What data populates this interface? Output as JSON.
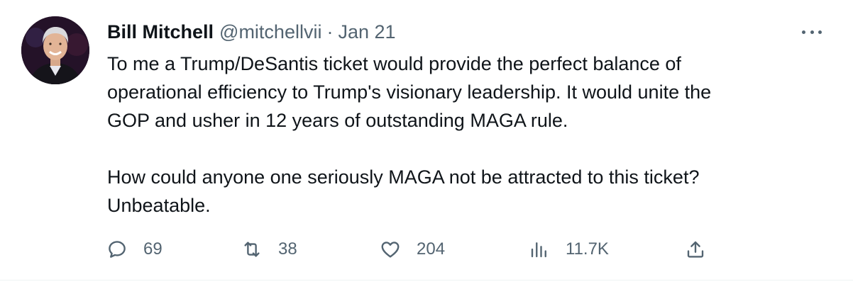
{
  "tweet": {
    "display_name": "Bill Mitchell",
    "handle": "@mitchellvii",
    "separator": "·",
    "date": "Jan 21",
    "lines": [
      "To me a Trump/DeSantis ticket would provide the perfect balance of",
      "operational efficiency to Trump's visionary leadership. It would unite the",
      "GOP and usher in 12 years of outstanding MAGA rule."
    ],
    "lines2": [
      "How could anyone one seriously MAGA not be attracted to this ticket?",
      "Unbeatable."
    ]
  },
  "actions": {
    "replies": "69",
    "retweets": "38",
    "likes": "204",
    "views": "11.7K"
  },
  "colors": {
    "text_primary": "#0f1419",
    "text_secondary": "#536471",
    "divider": "#eff3f4"
  },
  "icons": {
    "reply": "reply-icon",
    "retweet": "retweet-icon",
    "like": "heart-icon",
    "views": "views-icon",
    "share": "share-icon",
    "more": "more-icon"
  }
}
